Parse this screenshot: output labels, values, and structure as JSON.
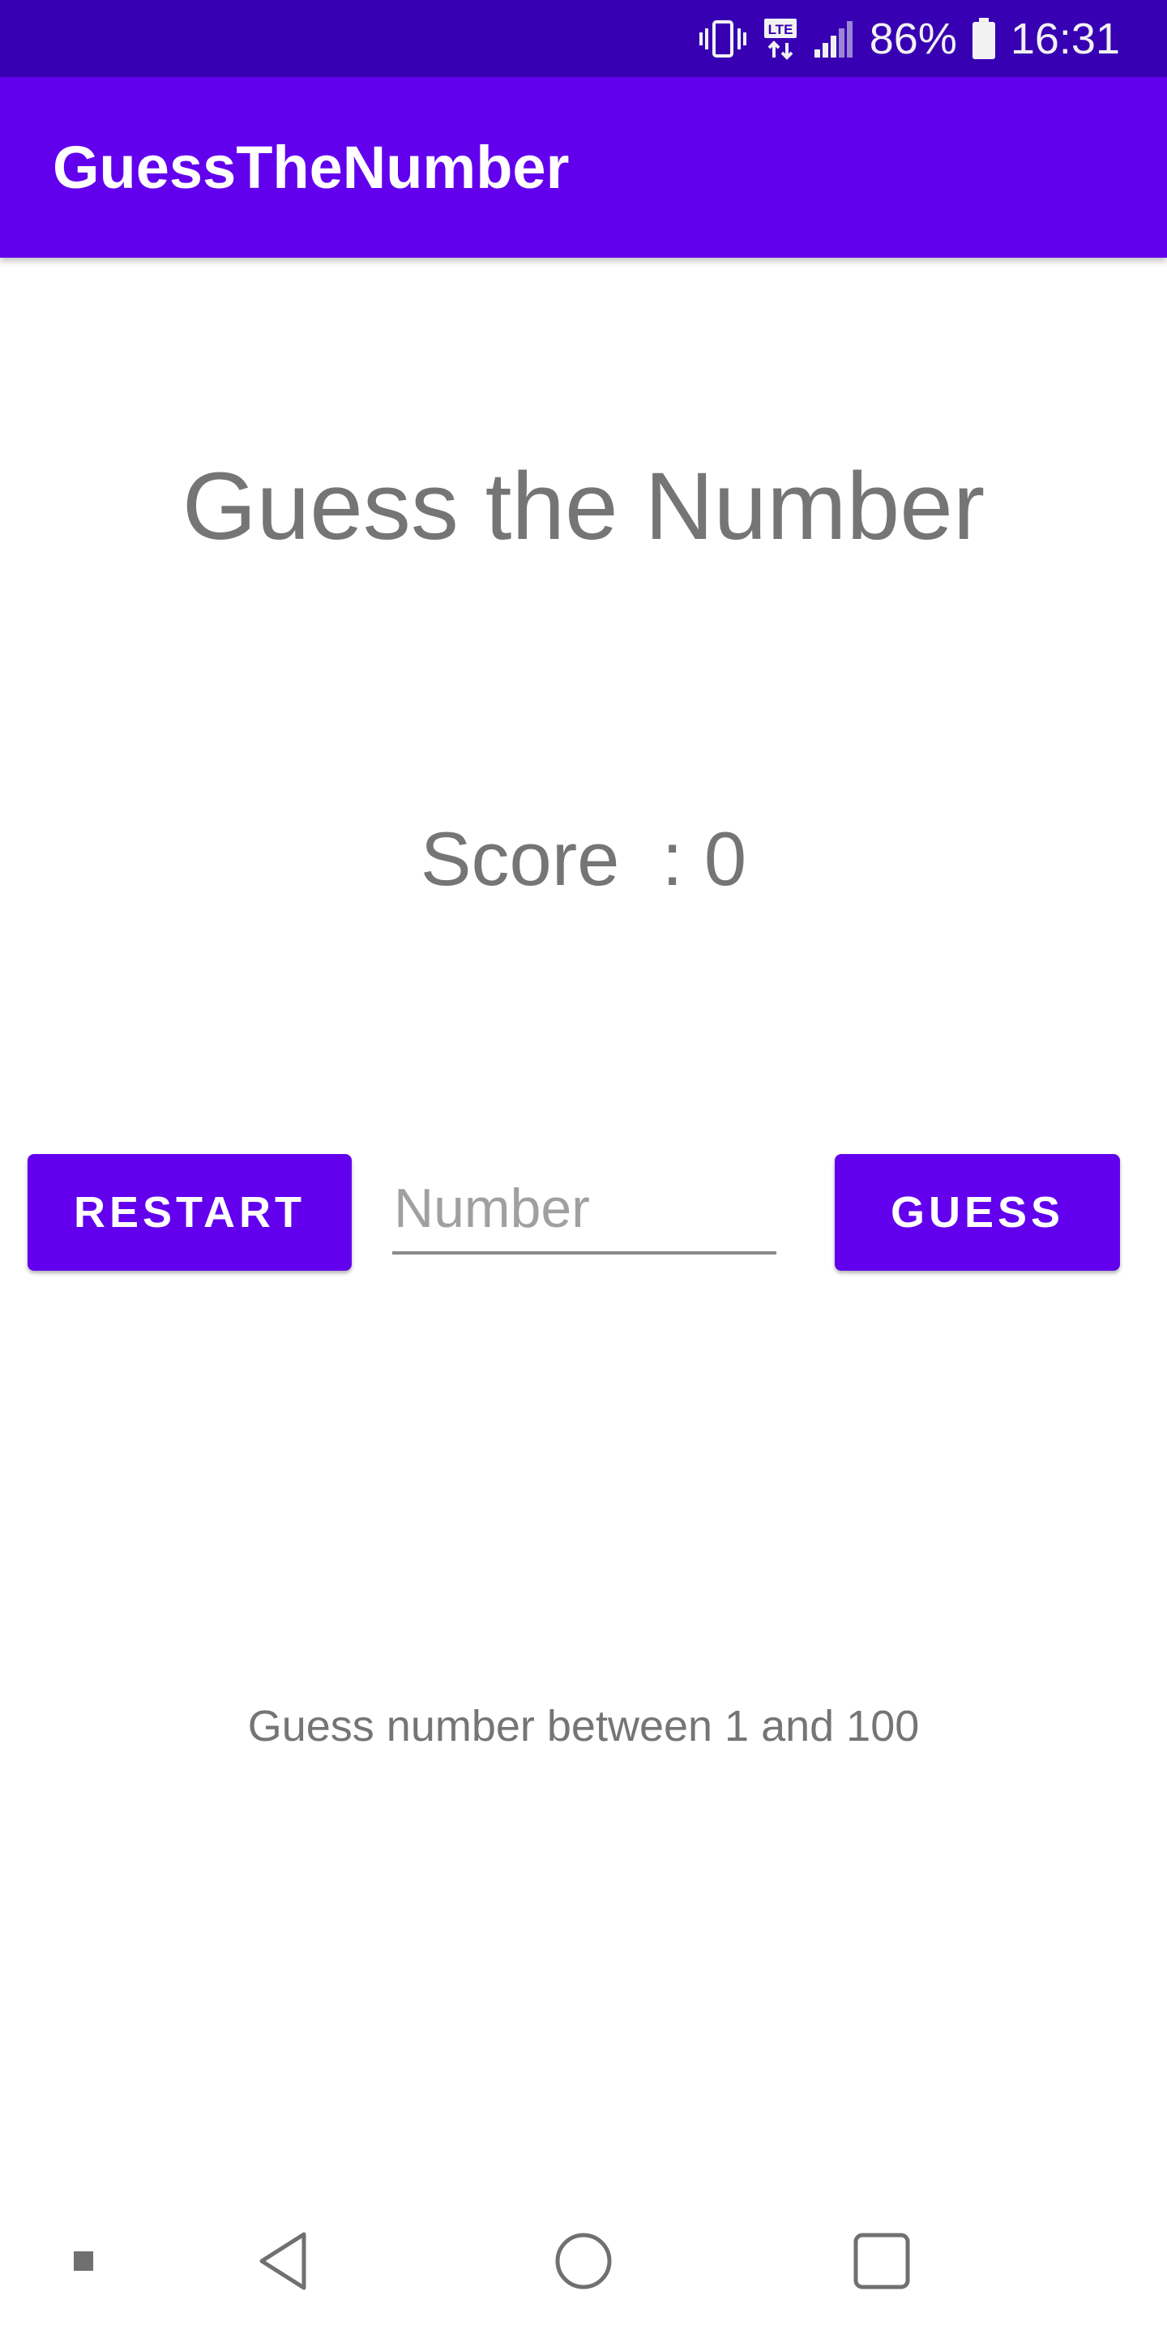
{
  "status_bar": {
    "icons": [
      "vibrate-icon",
      "lte-icon",
      "signal-icon",
      "battery-icon"
    ],
    "battery": "86%",
    "time": "16:31"
  },
  "app_bar": {
    "title": "GuessTheNumber",
    "color": "#6200ee"
  },
  "main": {
    "heading": "Guess the Number",
    "score_text": "Score  : 0",
    "restart_label": "RESTART",
    "number_placeholder": "Number",
    "number_value": "",
    "guess_label": "GUESS",
    "hint": "Guess number between 1 and 100"
  },
  "nav_bar": {
    "icons": [
      "menu-dot-icon",
      "back-icon",
      "home-icon",
      "recents-icon"
    ]
  },
  "colors": {
    "status_bar": "#3700b3",
    "primary": "#6200ee",
    "text_gray": "#757575"
  }
}
